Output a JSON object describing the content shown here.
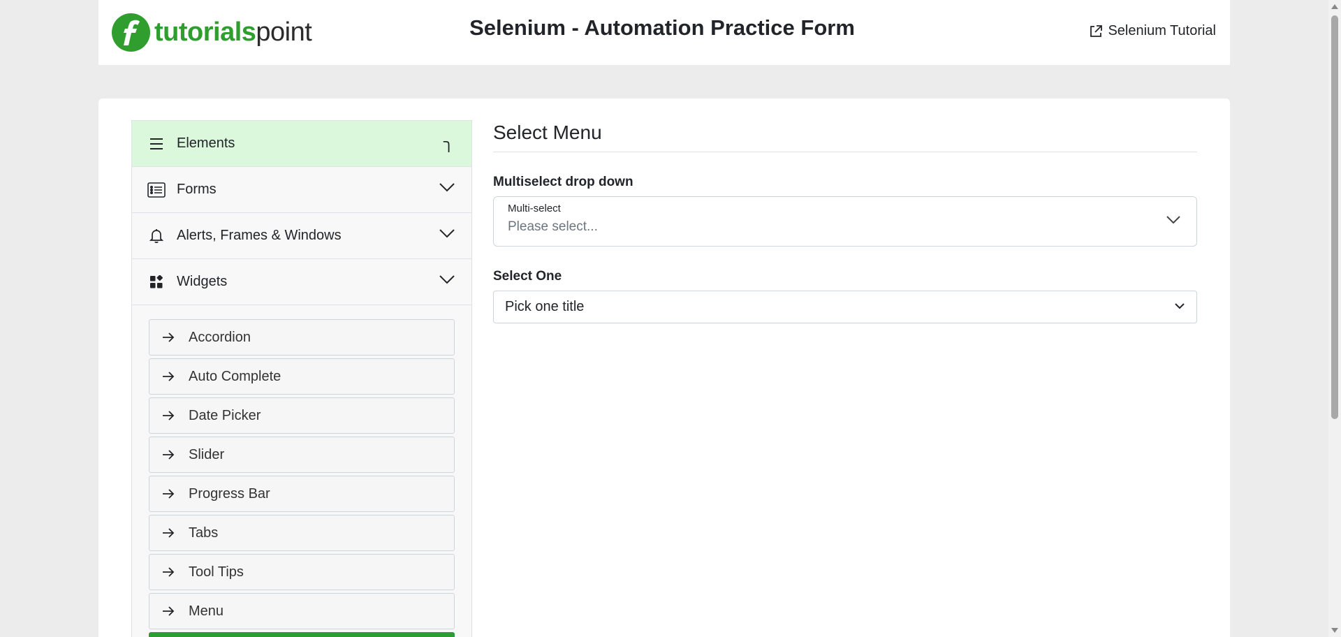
{
  "header": {
    "logo_brand": "tutorials",
    "logo_suffix": "point",
    "title": "Selenium - Automation Practice Form",
    "link_label": "Selenium Tutorial",
    "link_icon": "external-link-icon"
  },
  "sidebar": {
    "sections": [
      {
        "label": "Elements",
        "icon": "hamburger-icon",
        "state": "active"
      },
      {
        "label": "Forms",
        "icon": "list-icon",
        "state": "collapsed"
      },
      {
        "label": "Alerts, Frames & Windows",
        "icon": "bell-icon",
        "state": "collapsed"
      },
      {
        "label": "Widgets",
        "icon": "widgets-icon",
        "state": "expanded"
      }
    ],
    "active_marker": "ך",
    "widget_items": [
      {
        "label": "Accordion"
      },
      {
        "label": "Auto Complete"
      },
      {
        "label": "Date Picker"
      },
      {
        "label": "Slider"
      },
      {
        "label": "Progress Bar"
      },
      {
        "label": "Tabs"
      },
      {
        "label": "Tool Tips"
      },
      {
        "label": "Menu"
      }
    ],
    "item_icon": "arrow-right-icon"
  },
  "main": {
    "section_title": "Select Menu",
    "multiselect": {
      "label": "Multiselect drop down",
      "float_label": "Multi-select",
      "placeholder": "Please select..."
    },
    "select_one": {
      "label": "Select One",
      "value": "Pick one title"
    }
  },
  "colors": {
    "brand_green": "#2f9e2f",
    "active_bg": "#dcf8dc",
    "selected_item": "#2e9b36"
  }
}
